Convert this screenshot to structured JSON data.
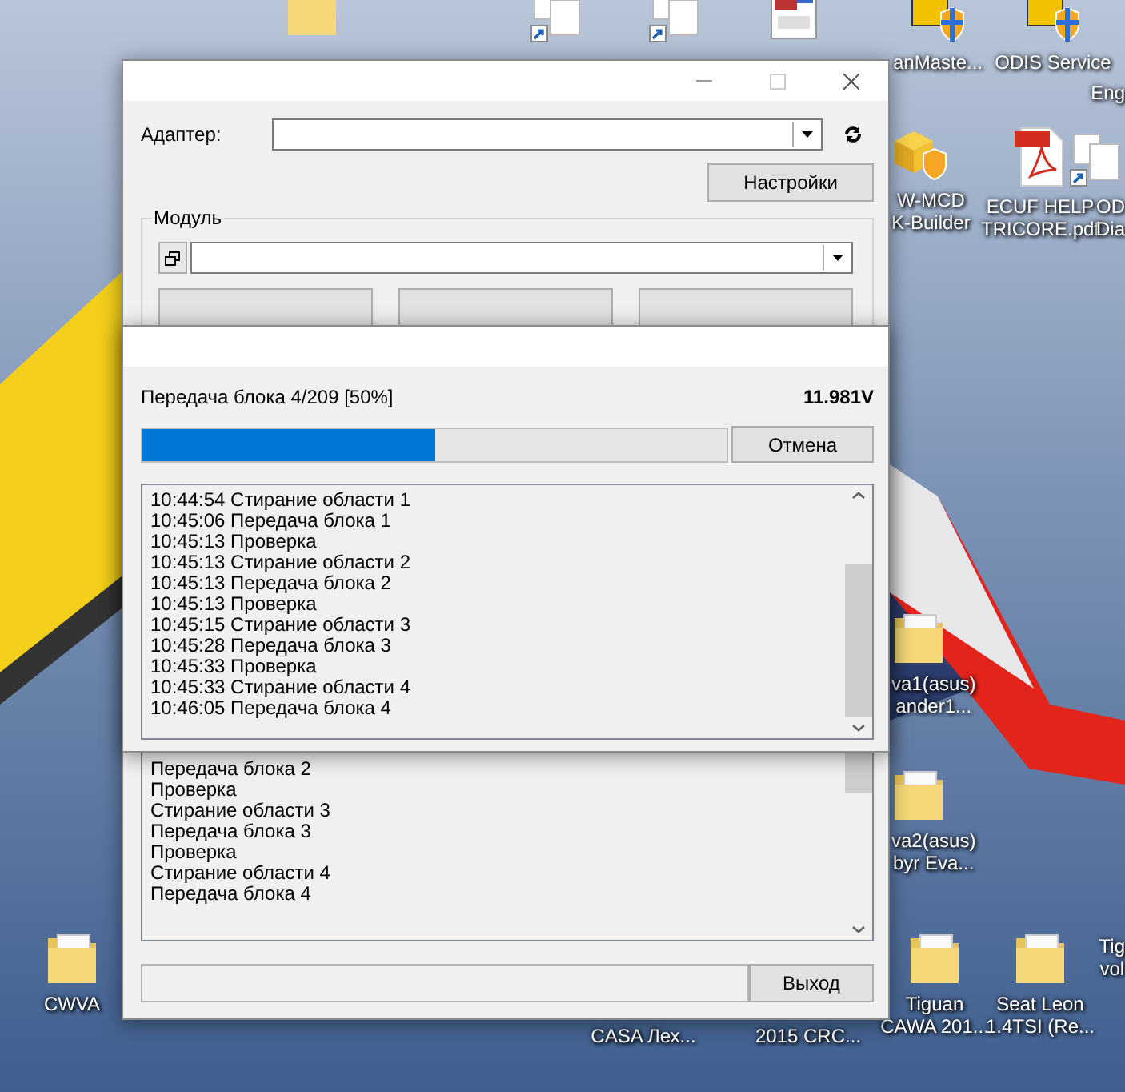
{
  "desktop": {
    "icons": [
      {
        "kind": "folder"
      },
      {
        "kind": "shortcut"
      },
      {
        "kind": "shortcut"
      },
      {
        "kind": "app"
      },
      {
        "kind": "shield",
        "label": [
          "anMaste..."
        ]
      },
      {
        "kind": "shield",
        "label": [
          "ODIS Service"
        ]
      },
      {
        "kind": "none",
        "label": [
          "Eng"
        ]
      },
      {
        "kind": "installer",
        "label": [
          "W-MCD",
          "K-Builder"
        ]
      },
      {
        "kind": "pdf",
        "label": [
          "ECUF HELP",
          "TRICORE.pdf"
        ]
      },
      {
        "kind": "shortcut",
        "label": [
          "OD",
          "Dia"
        ]
      },
      {
        "kind": "folder",
        "label": [
          "va1(asus)",
          "ander1..."
        ]
      },
      {
        "kind": "folder",
        "label": [
          "va2(asus)",
          "byr Eva..."
        ]
      },
      {
        "kind": "folder",
        "label": [
          "Tiguan",
          "CAWA 201..."
        ]
      },
      {
        "kind": "folder",
        "label": [
          "Seat Leon",
          "1.4TSI (Re..."
        ]
      },
      {
        "kind": "none",
        "label": [
          "Tig",
          "vol"
        ]
      },
      {
        "kind": "folder",
        "label": [
          "CWVA"
        ]
      },
      {
        "kind": "none",
        "label": [
          "CASA Лех..."
        ]
      },
      {
        "kind": "none",
        "label": [
          "2015 CRC..."
        ]
      }
    ]
  },
  "main_window": {
    "adapter_label": "Адаптер:",
    "settings_button": "Настройки",
    "module_group_label": "Модуль",
    "log_lines": [
      "Передача блока 2",
      "Проверка",
      "Стирание области 3",
      "Передача блока 3",
      "Проверка",
      "Стирание области 4",
      "Передача блока 4"
    ],
    "exit_button": "Выход"
  },
  "progress_dialog": {
    "status": "Передача блока 4/209 [50%]",
    "voltage": "11.981V",
    "progress": {
      "level": 0.5
    },
    "cancel_button": "Отмена",
    "log_lines": [
      "10:44:54 Стирание области 1",
      "10:45:06 Передача блока 1",
      "10:45:13 Проверка",
      "10:45:13 Стирание области 2",
      "10:45:13 Передача блока 2",
      "10:45:13 Проверка",
      "10:45:15 Стирание области 3",
      "10:45:28 Передача блока 3",
      "10:45:33 Проверка",
      "10:45:33 Стирание области 4",
      "10:46:05 Передача блока 4"
    ]
  }
}
